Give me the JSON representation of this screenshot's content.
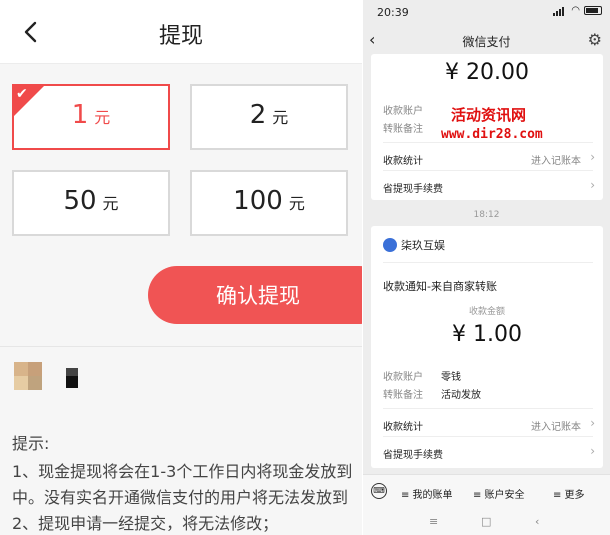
{
  "left": {
    "title": "提现",
    "amounts": [
      {
        "value": "1",
        "unit": "元",
        "selected": true
      },
      {
        "value": "2",
        "unit": "元",
        "selected": false
      },
      {
        "value": "50",
        "unit": "元",
        "selected": false
      },
      {
        "value": "100",
        "unit": "元",
        "selected": false
      }
    ],
    "confirm_label": "确认提现",
    "tips_title": "提示:",
    "tips": [
      "1、现金提现将会在1-3个工作日内将现金发放到",
      "中。没有实名开通微信支付的用户将无法发放到",
      "2、提现申请一经提交，将无法修改；"
    ],
    "accent_color": "#f04a4a"
  },
  "right": {
    "status_time": "20:39",
    "nav_title": "微信支付",
    "card1": {
      "amount": "¥ 20.00",
      "label_account": "收款账户",
      "label_note": "转账备注",
      "stats_label": "收款统计",
      "stats_link": "进入记账本",
      "fee_label": "省提现手续费"
    },
    "watermark": {
      "title": "活动资讯网",
      "url": "www.dir28.com"
    },
    "time_separator": "18:12",
    "card2": {
      "brand": "柒玖互娱",
      "notice": "收款通知-来自商家转账",
      "amount_label": "收款金额",
      "amount": "¥ 1.00",
      "label_account": "收款账户",
      "account_value": "零钱",
      "label_note": "转账备注",
      "note_value": "活动发放",
      "stats_label": "收款统计",
      "stats_link": "进入记账本",
      "fee_label": "省提现手续费"
    },
    "bottom_menu": [
      "≡ 我的账单",
      "≡ 账户安全",
      "≡ 更多"
    ],
    "sys_nav": [
      "≡",
      "□",
      "‹"
    ]
  }
}
